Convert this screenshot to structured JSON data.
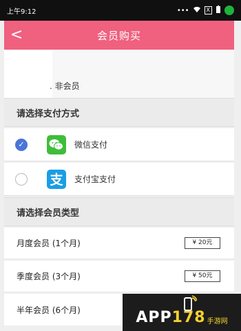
{
  "status_bar": {
    "time": "上午9:12",
    "icons": [
      "dots-icon",
      "wifi-icon",
      "sim-icon",
      "battery-icon"
    ],
    "sim_badge": "X"
  },
  "header": {
    "back_icon": "chevron-left-icon",
    "title": "会员购买",
    "bg_color": "#f0607f"
  },
  "account": {
    "member_status": ". 非会员"
  },
  "payment": {
    "section_title": "请选择支付方式",
    "options": [
      {
        "label": "微信支付",
        "icon": "wechat-icon",
        "selected": true
      },
      {
        "label": "支付宝支付",
        "icon": "alipay-icon",
        "icon_glyph": "支",
        "selected": false
      }
    ]
  },
  "membership": {
    "section_title": "请选择会员类型",
    "plans": [
      {
        "name": "月度会员 (1个月)",
        "price": "¥ 20元"
      },
      {
        "name": "季度会员 (3个月)",
        "price": "¥ 50元"
      },
      {
        "name": "半年会员 (6个月)",
        "price": ""
      }
    ]
  },
  "watermark": {
    "prefix": "APP",
    "number": "178",
    "suffix": "手游网"
  }
}
